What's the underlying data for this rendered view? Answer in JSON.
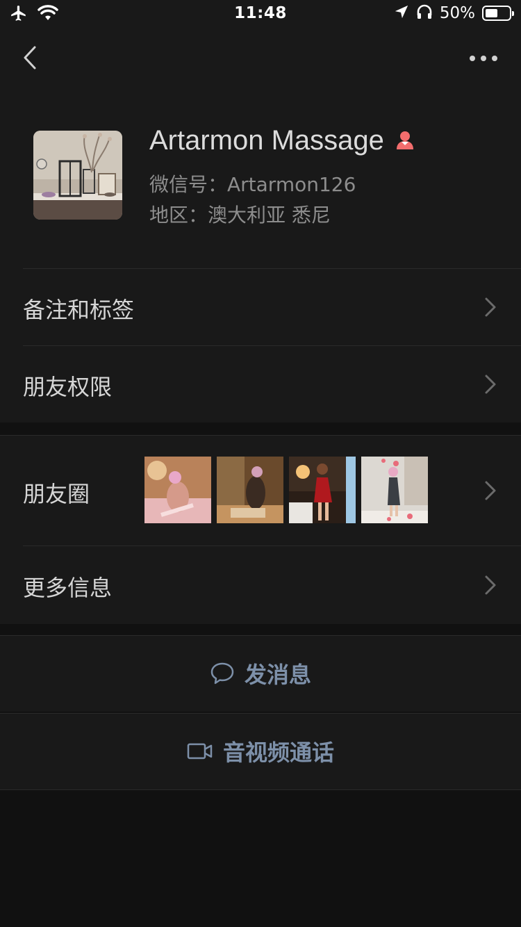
{
  "status_bar": {
    "time": "11:48",
    "battery_text": "50%",
    "battery_level": 0.5,
    "icons": [
      "airplane-icon",
      "wifi-icon",
      "location-icon",
      "headphones-icon",
      "battery-icon"
    ]
  },
  "nav": {
    "back_icon": "chevron-left-icon",
    "more_icon": "more-dots-icon"
  },
  "profile": {
    "name": "Artarmon Massage",
    "gender_icon": "female-icon",
    "wechat_id": "微信号：Artarmon126",
    "region": "地区：澳大利亚 悉尼"
  },
  "cells": {
    "remarks_tags": "备注和标签",
    "friend_permissions": "朋友权限",
    "moments": "朋友圈",
    "more_info": "更多信息"
  },
  "actions": {
    "send_message": "发消息",
    "video_call": "音视频通话"
  },
  "colors": {
    "background": "#111111",
    "panel": "#191919",
    "action_text": "#7d90a9",
    "gender_icon": "#f26d6d"
  }
}
